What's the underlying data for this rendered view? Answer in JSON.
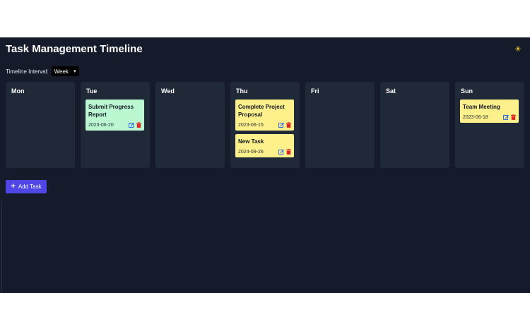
{
  "app": {
    "title": "Task Management Timeline",
    "theme_icon": "sun-icon",
    "interval_label": "Timeline Interval:",
    "interval_value": "Week",
    "add_task_label": "Add Task"
  },
  "days": [
    {
      "name": "Mon",
      "tasks": []
    },
    {
      "name": "Tue",
      "tasks": [
        {
          "title": "Submit Progress Report",
          "date": "2023-06-20",
          "color": "green"
        }
      ]
    },
    {
      "name": "Wed",
      "tasks": []
    },
    {
      "name": "Thu",
      "tasks": [
        {
          "title": "Complete Project Proposal",
          "date": "2023-06-15",
          "color": "yellow"
        },
        {
          "title": "New Task",
          "date": "2024-09-26",
          "color": "yellow"
        }
      ]
    },
    {
      "name": "Fri",
      "tasks": []
    },
    {
      "name": "Sat",
      "tasks": []
    },
    {
      "name": "Sun",
      "tasks": [
        {
          "title": "Team Meeting",
          "date": "2023-06-18",
          "color": "yellow"
        }
      ]
    }
  ],
  "colors": {
    "background": "#151b2b",
    "column": "#1f2937",
    "task_green": "#bbf7d0",
    "task_yellow": "#fef08a",
    "accent": "#4f46e5",
    "edit_icon": "#2563eb",
    "delete_icon": "#dc2626",
    "theme_icon": "#facc15"
  }
}
